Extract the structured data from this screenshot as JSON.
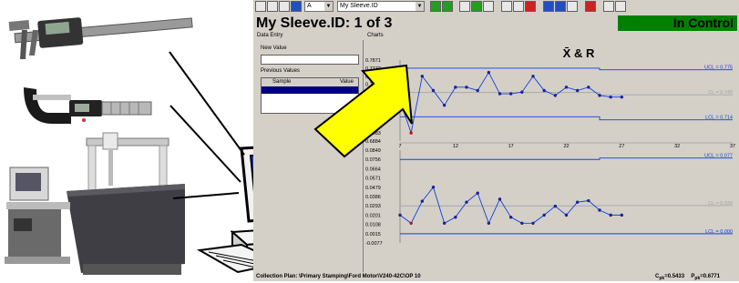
{
  "toolbar": {
    "combo_a": "A",
    "combo_sleeve": "My Sleeve.ID"
  },
  "titlebar": {
    "title": "My Sleeve.ID:  1 of 3",
    "status": "In Control"
  },
  "panels": {
    "data_entry_header": "Data Entry",
    "charts_header": "Charts"
  },
  "data_entry": {
    "new_value_label": "New Value",
    "previous_values_label": "Previous Values",
    "col_sample": "Sample",
    "col_value": "Value"
  },
  "footer": {
    "collection_plan": "Collection Plan:  \\Primary Stamping\\Ford Motor\\V240-42C\\OP 10",
    "cpk": "C",
    "cpk_sub": "pk",
    "cpk_value": "=0.5433",
    "ppk": "P",
    "ppk_sub": "pk",
    "ppk_value": "=0.6771"
  },
  "colors": {
    "panel_bg": "#d4d0c8",
    "status_green": "#008000",
    "line_blue": "#1040e0",
    "point_navy": "#202090",
    "point_red": "#c01010",
    "arrow_yellow": "#ffff00",
    "selection_blue": "#000080"
  },
  "icons": [
    "caliper-icon",
    "micrometer-icon",
    "cmm-machine-icon",
    "computer-icon",
    "arrow-icon"
  ],
  "chart_data": {
    "type": "line",
    "title": "X̄ & R",
    "xbar": {
      "y_ticks": [
        "0.7871",
        "0.7772",
        "0.7674",
        "0.7575",
        "0.7476",
        "0.7378",
        "0.7279",
        "0.7180",
        "0.7082",
        "0.6983",
        "0.6884"
      ],
      "ylim": [
        0.6884,
        0.7871
      ],
      "ucl_label": "UCL = 0.775",
      "cl_label": "CL = 0.745",
      "lcl_label": "LCL = 0.714",
      "limits_before": {
        "ucl": 0.7772,
        "cl": 0.7476,
        "lcl": 0.718
      },
      "limits_after": {
        "ucl": 0.7752,
        "cl": 0.7447,
        "lcl": 0.7143
      },
      "limit_change_x": 25,
      "x": [
        7,
        8,
        9,
        10,
        11,
        12,
        13,
        14,
        15,
        16,
        17,
        18,
        19,
        20,
        21,
        22,
        23,
        24,
        25,
        26,
        27
      ],
      "values": [
        0.7378,
        0.6983,
        0.7674,
        0.75,
        0.732,
        0.754,
        0.754,
        0.75,
        0.772,
        0.746,
        0.746,
        0.748,
        0.7674,
        0.75,
        0.744,
        0.754,
        0.75,
        0.754,
        0.744,
        0.742,
        0.742
      ]
    },
    "range": {
      "y_ticks": [
        "0.0849",
        "0.0756",
        "0.0664",
        "0.0571",
        "0.0479",
        "0.0386",
        "0.0293",
        "0.0201",
        "0.0108",
        "0.0015",
        "-0.0077"
      ],
      "ylim": [
        -0.0077,
        0.0849
      ],
      "ucl_label": "UCL = 0.077",
      "cl_label": "CL = 0.030",
      "lcl_label": "LCL = 0.000",
      "limits_before": {
        "ucl": 0.0756,
        "cl": 0.0293,
        "lcl": 0.0015
      },
      "limits_after": {
        "ucl": 0.077,
        "cl": 0.0296,
        "lcl": 0.0015
      },
      "limit_change_x": 25,
      "x": [
        7,
        8,
        9,
        10,
        11,
        12,
        13,
        14,
        15,
        16,
        17,
        18,
        19,
        20,
        21,
        22,
        23,
        24,
        25,
        26,
        27
      ],
      "values": [
        0.0201,
        0.012,
        0.034,
        0.0479,
        0.012,
        0.018,
        0.033,
        0.042,
        0.012,
        0.036,
        0.018,
        0.012,
        0.012,
        0.0201,
        0.029,
        0.0201,
        0.033,
        0.0345,
        0.025,
        0.0201,
        0.0201
      ]
    },
    "x_ticks": [
      "7",
      "12",
      "17",
      "22",
      "27",
      "32",
      "37"
    ],
    "xlim": [
      7,
      37
    ]
  }
}
